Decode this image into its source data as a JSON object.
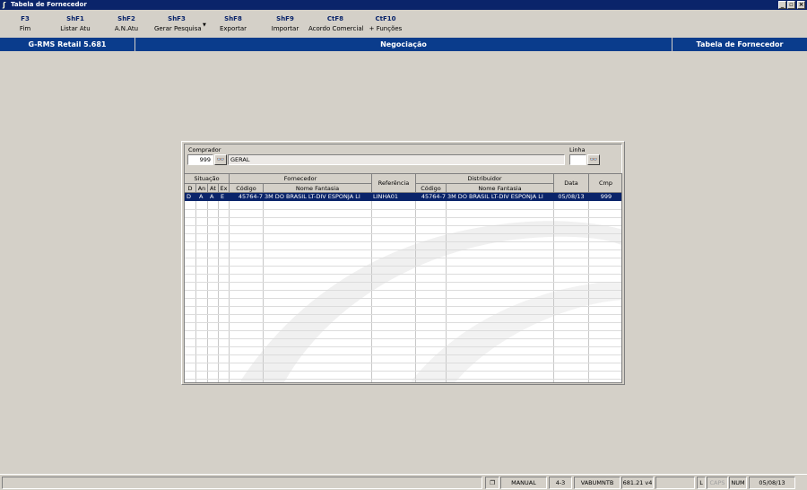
{
  "window": {
    "title": "Tabela de Fornecedor",
    "controls": [
      "minimize",
      "restore",
      "close"
    ]
  },
  "toolbar": [
    {
      "key": "F3",
      "label": "Fim"
    },
    {
      "key": "ShF1",
      "label": "Listar Atu"
    },
    {
      "key": "ShF2",
      "label": "A.N.Atu"
    },
    {
      "key": "ShF3",
      "label": "Gerar Pesquisa"
    },
    {
      "key": "ShF8",
      "label": "Exportar"
    },
    {
      "key": "ShF9",
      "label": "Importar"
    },
    {
      "key": "CtF8",
      "label": "Acordo Comercial"
    },
    {
      "key": "CtF10",
      "label": "+ Funções"
    }
  ],
  "header": {
    "app": "G-RMS Retail 5.681",
    "module": "Negociação",
    "screen": "Tabela de Fornecedor"
  },
  "form": {
    "comprador_label": "Comprador",
    "comprador_code": "999",
    "comprador_name": "GERAL",
    "linha_label": "Linha",
    "linha_value": ""
  },
  "grid": {
    "groups": {
      "situacao": "Situação",
      "fornecedor": "Fornecedor",
      "referencia": "Referência",
      "distribuidor": "Distribuidor",
      "data": "Data",
      "cmp": "Cmp"
    },
    "columns": {
      "d": "D",
      "an": "An",
      "at": "At",
      "ex": "Ex",
      "forn_codigo": "Código",
      "forn_nome": "Nome Fantasia",
      "dist_codigo": "Código",
      "dist_nome": "Nome Fantasia"
    },
    "rows": [
      {
        "d": "D",
        "an": "A",
        "at": "A",
        "ex": "E",
        "forn_codigo": "45764-7",
        "forn_nome": "3M DO BRASIL LT-DIV ESPONJA LI",
        "referencia": "LINHA01",
        "dist_codigo": "45764-7",
        "dist_nome": "3M DO BRASIL LT-DIV ESPONJA LI",
        "data": "05/08/13",
        "cmp": "999"
      }
    ]
  },
  "status": {
    "mode": "MANUAL",
    "code": "4-3",
    "user": "VABUMNTB",
    "version": "681.21 v4",
    "l": "L",
    "caps": "CAPS",
    "num": "NUM",
    "date": "05/08/13"
  },
  "colors": {
    "titlebar": "#0a246a",
    "header_strip": "#0a3c8c",
    "selection": "#0a246a",
    "key_text": "#0a246a"
  }
}
